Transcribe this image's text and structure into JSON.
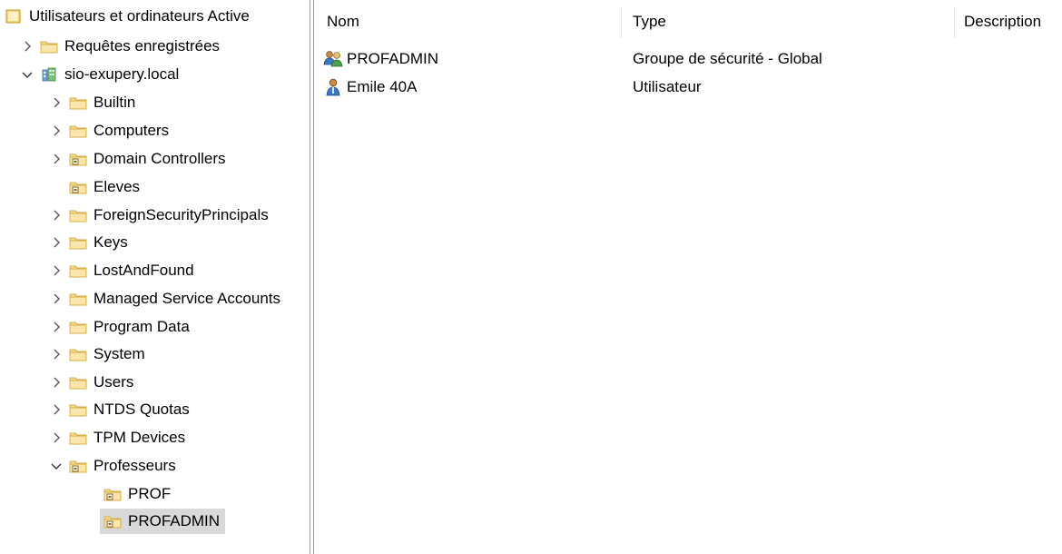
{
  "tree": {
    "root_label": "Utilisateurs et ordinateurs Active",
    "saved_queries": "Requêtes enregistrées",
    "domain": "sio-exupery.local",
    "containers": {
      "builtin": "Builtin",
      "computers": "Computers",
      "domain_controllers": "Domain Controllers",
      "eleves": "Eleves",
      "foreign": "ForeignSecurityPrincipals",
      "keys": "Keys",
      "lostandfound": "LostAndFound",
      "managed": "Managed Service Accounts",
      "program_data": "Program Data",
      "system": "System",
      "users": "Users",
      "ntds": "NTDS Quotas",
      "tpm": "TPM Devices",
      "professeurs": "Professeurs",
      "prof": "PROF",
      "profadmin": "PROFADMIN"
    },
    "selected": "PROFADMIN"
  },
  "list": {
    "columns": {
      "name": "Nom",
      "type": "Type",
      "description": "Description"
    },
    "rows": [
      {
        "name": "PROFADMIN",
        "type": "Groupe de sécurité - Global",
        "icon": "group-icon"
      },
      {
        "name": "Emile 40A",
        "type": "Utilisateur",
        "icon": "user-icon"
      }
    ]
  },
  "colors": {
    "folder": "#f2d27a",
    "selection": "#d9d9d9",
    "ou_badge": "#8a6a2a"
  }
}
